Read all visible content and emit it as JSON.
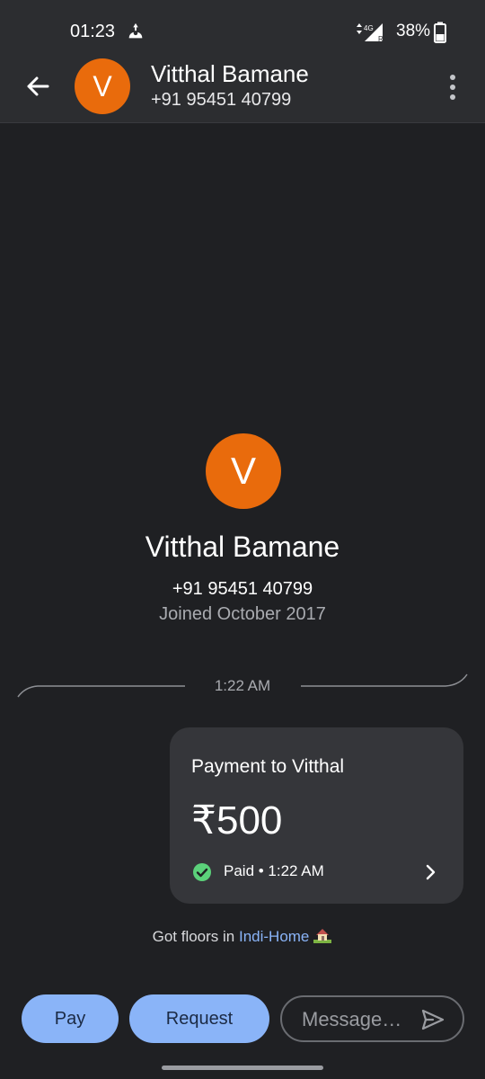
{
  "status_bar": {
    "time": "01:23",
    "network": "4G",
    "battery": "38%",
    "icons": [
      "drive-upload-icon",
      "signal-4g-icon",
      "battery-icon"
    ]
  },
  "header": {
    "avatar_initial": "V",
    "name": "Vitthal Bamane",
    "phone": "+91 95451 40799",
    "icons": [
      "back-arrow-icon",
      "more-vert-icon"
    ]
  },
  "profile": {
    "avatar_initial": "V",
    "name": "Vitthal Bamane",
    "phone": "+91 95451 40799",
    "joined": "Joined October 2017"
  },
  "divider": {
    "time": "1:22 AM"
  },
  "payment": {
    "title": "Payment to Vitthal",
    "amount": "₹500",
    "status": "Paid • 1:22 AM",
    "icons": [
      "check-circle-icon",
      "chevron-right-icon"
    ]
  },
  "note": {
    "prefix": "Got floors in ",
    "link": "Indi-Home",
    "icon": "house-emoji-icon"
  },
  "actions": {
    "pay_label": "Pay",
    "request_label": "Request",
    "message_placeholder": "Message…",
    "icons": [
      "send-icon"
    ]
  },
  "colors": {
    "background": "#1f2023",
    "header": "#2c2d30",
    "card": "#35363a",
    "avatar": "#e96b0c",
    "accent_button": "#8ab4f8",
    "link": "#8ab4f8",
    "paid_green": "#5bd17a"
  }
}
